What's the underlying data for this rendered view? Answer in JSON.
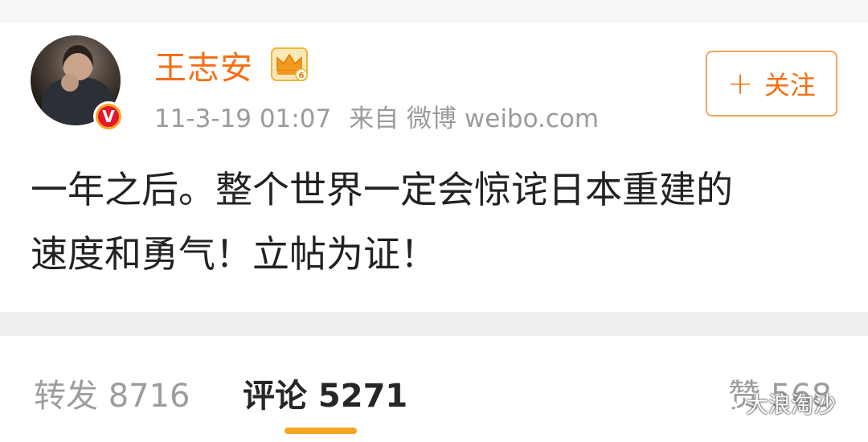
{
  "post": {
    "username": "王志安",
    "badge_icon": "crown-level-6-icon",
    "verified_mark": "V",
    "timestamp": "11-3-19 01:07",
    "source": "来自 微博 weibo.com",
    "content_line1": "一年之后。整个世界一定会惊诧日本重建的",
    "content_line2": "速度和勇气！立帖为证！",
    "follow_label": "关注",
    "follow_icon": "plus-icon"
  },
  "tabs": {
    "repost": "转发 8716",
    "comment": "评论 5271",
    "like": "赞 568",
    "active": "comment"
  },
  "watermark": {
    "text": "大浪淘沙",
    "icon": "wechat-icon"
  },
  "colors": {
    "accent_orange": "#f86e13",
    "indicator": "#f6a623",
    "verified_red": "#e6162d"
  }
}
